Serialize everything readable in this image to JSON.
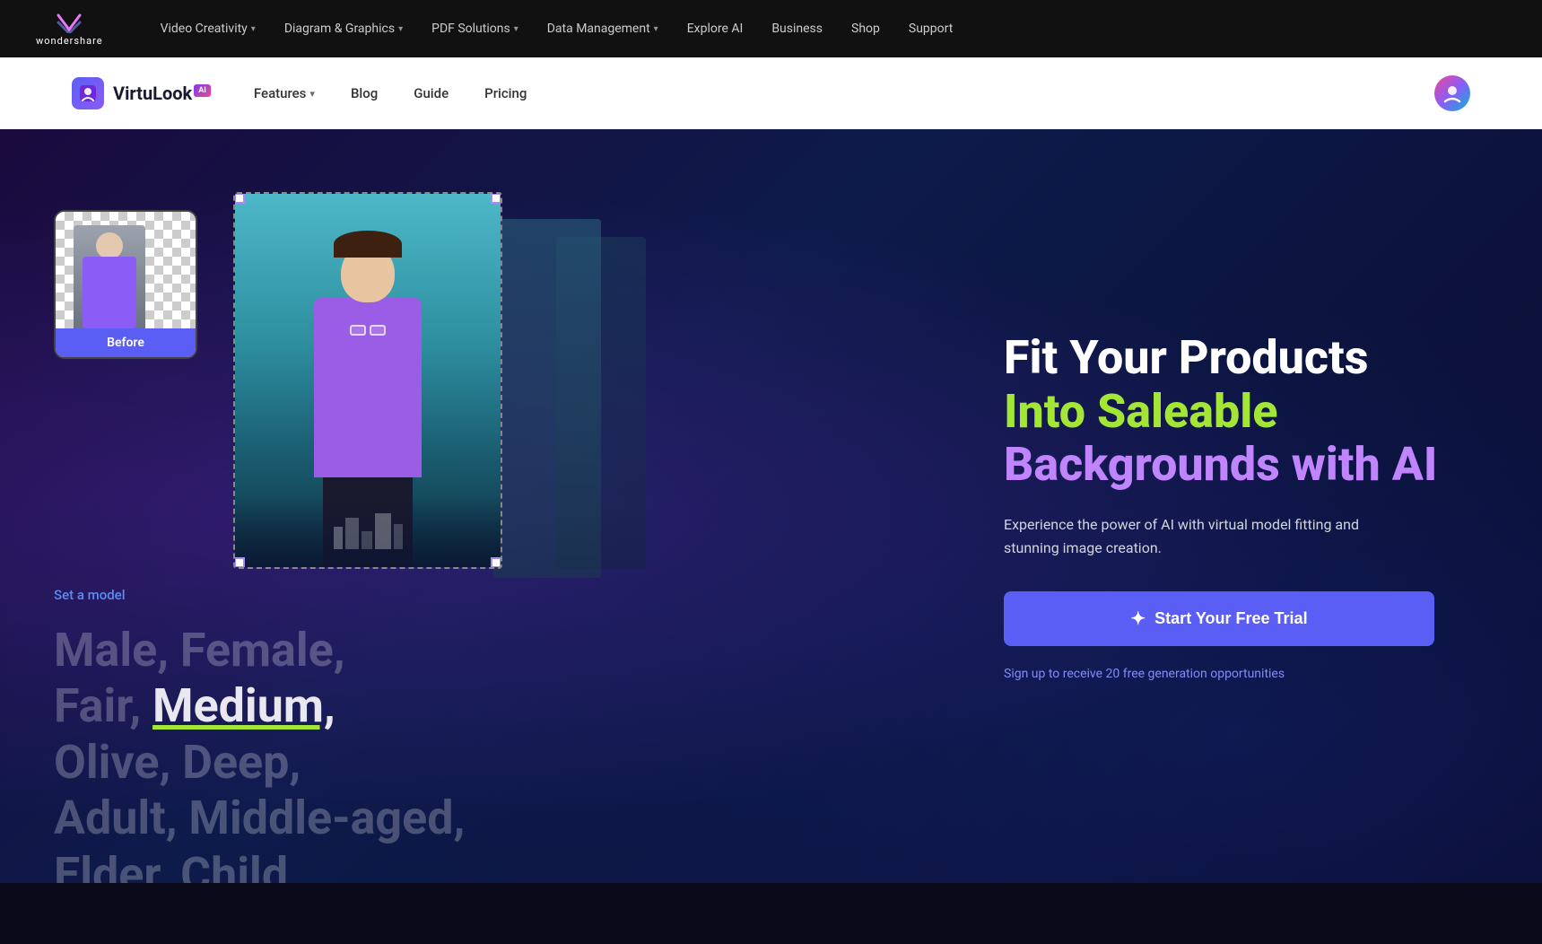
{
  "topNav": {
    "logo": {
      "text": "wondershare"
    },
    "items": [
      {
        "label": "Video Creativity",
        "hasDropdown": true
      },
      {
        "label": "Diagram & Graphics",
        "hasDropdown": true
      },
      {
        "label": "PDF Solutions",
        "hasDropdown": true
      },
      {
        "label": "Data Management",
        "hasDropdown": true
      },
      {
        "label": "Explore AI",
        "hasDropdown": false
      },
      {
        "label": "Business",
        "hasDropdown": false
      },
      {
        "label": "Shop",
        "hasDropdown": false
      },
      {
        "label": "Support",
        "hasDropdown": false
      }
    ]
  },
  "secondNav": {
    "brand": {
      "name": "VirtuLook",
      "aiBadge": "AI"
    },
    "items": [
      {
        "label": "Features",
        "hasDropdown": true
      },
      {
        "label": "Blog",
        "hasDropdown": false
      },
      {
        "label": "Guide",
        "hasDropdown": false
      },
      {
        "label": "Pricing",
        "hasDropdown": false
      }
    ]
  },
  "hero": {
    "beforeLabel": "Before",
    "setModelLink": "Set a model",
    "modelOptionsLine1": "Male, Female,",
    "modelOptionsLine2": "Fair, Medium,",
    "modelOptionsLine3": "Olive, Deep,",
    "modelOptionsLine4": "Adult, Middle-aged,",
    "modelOptionsLine5": "Elder, Child",
    "highlightWord": "Medium,",
    "headline": {
      "line1": "Fit Your Products",
      "line2": "Into Saleable",
      "line3": "Backgrounds with AI"
    },
    "subtext": "Experience the power of AI with virtual model fitting and stunning image creation.",
    "ctaButton": "Start Your Free Trial",
    "ctaSubLink": "Sign up to receive 20 free generation opportunities"
  }
}
